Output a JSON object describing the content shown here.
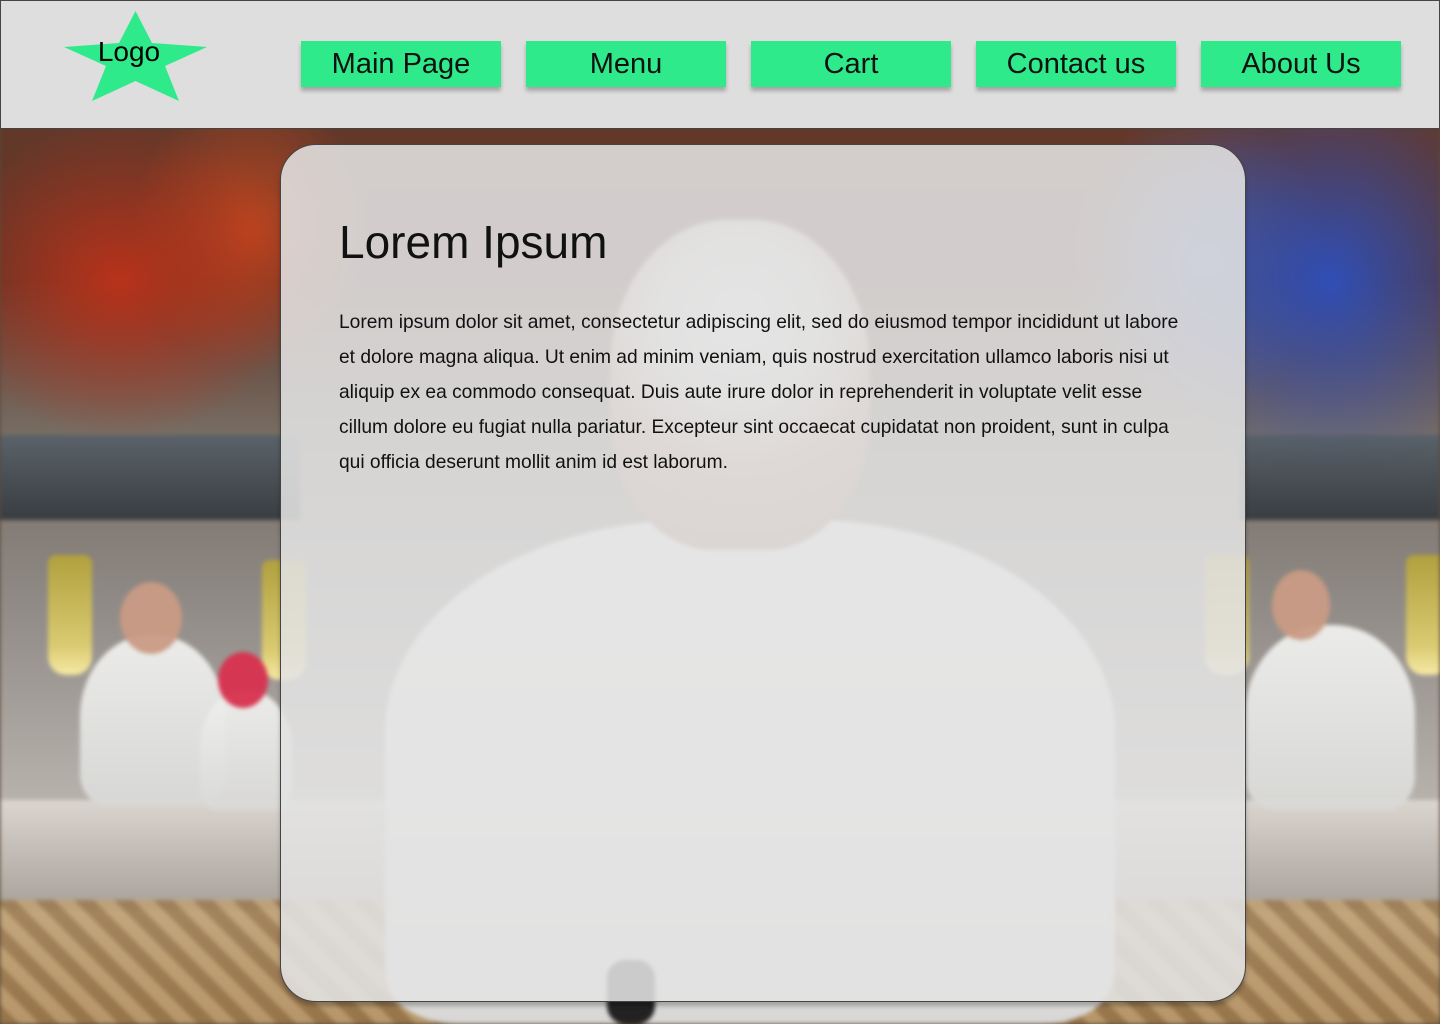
{
  "header": {
    "logo_text": "Logo",
    "nav": {
      "main_page": "Main Page",
      "menu": "Menu",
      "cart": "Cart",
      "contact_us": "Contact us",
      "about_us": "About Us"
    }
  },
  "main": {
    "title": "Lorem Ipsum",
    "body": "Lorem ipsum dolor sit amet, consectetur adipiscing elit, sed do eiusmod tempor incididunt ut labore et dolore magna aliqua. Ut enim ad minim veniam, quis nostrud exercitation ullamco laboris nisi ut aliquip ex ea commodo consequat. Duis aute irure dolor in reprehenderit in voluptate velit esse cillum dolore eu fugiat nulla pariatur. Excepteur sint occaecat cupidatat non proident, sunt in culpa qui officia deserunt mollit anim id est laborum."
  },
  "theme": {
    "header_background": "#dedede",
    "nav_button_color": "#2eea8a",
    "logo_color": "#2eea8a",
    "content_card_background": "#e2e2e2",
    "border_color": "#444444"
  },
  "icons": {
    "logo": "star-icon"
  },
  "background": {
    "image": "blurred-restaurant-kitchen-with-chef-photo"
  }
}
